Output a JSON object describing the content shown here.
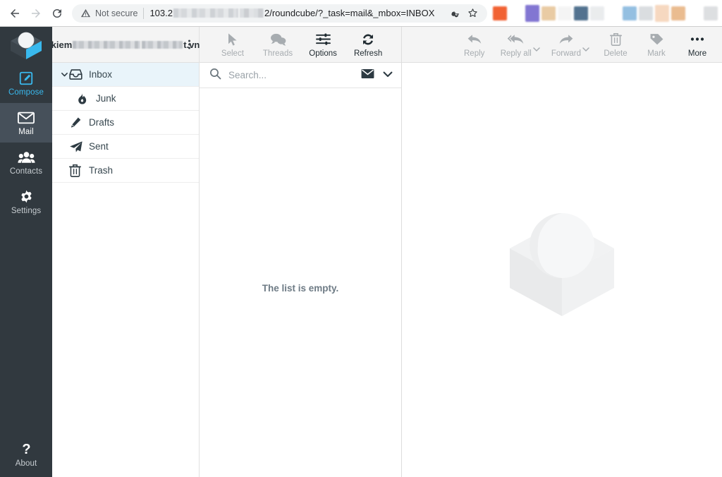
{
  "browser": {
    "back_icon": "arrow-left-icon",
    "forward_icon": "arrow-right-icon",
    "reload_icon": "reload-icon",
    "security_icon": "warning-triangle-icon",
    "security_label": "Not secure",
    "url_prefix": "103.2",
    "url_mid": "2",
    "url_suffix": "/roundcube/?_task=mail&_mbox=INBOX",
    "url_full": "103.2xx.xxx.xx2/roundcube/?_task=mail&_mbox=INBOX",
    "key_icon": "key-icon",
    "star_icon": "star-outline-icon",
    "extension_colors": [
      "#f15a29",
      "#7c6fd0",
      "#e8c9a0",
      "#4a6b8a",
      "#d8dadc",
      "#8fbce0",
      "#f6d6bd",
      "#e9b98b",
      "#dcdee0"
    ]
  },
  "taskmenu": {
    "brand_name": "roundcube-logo",
    "items": [
      {
        "label": "Compose",
        "icon": "compose-pencil-icon",
        "state": "link"
      },
      {
        "label": "Mail",
        "icon": "envelope-icon",
        "state": "active"
      },
      {
        "label": "Contacts",
        "icon": "people-icon",
        "state": "normal"
      },
      {
        "label": "Settings",
        "icon": "gear-icon",
        "state": "normal"
      }
    ],
    "about": {
      "label": "About",
      "icon": "question-mark-icon"
    }
  },
  "folders": {
    "account": "kiem@t.vn",
    "account_prefix": "kiem",
    "account_suffix": "t.vn",
    "options_icon": "kebab-menu-icon",
    "items": [
      {
        "label": "Inbox",
        "icon": "inbox-icon",
        "selected": true,
        "child": false,
        "twisty": "chevron-down-icon"
      },
      {
        "label": "Junk",
        "icon": "fire-icon",
        "selected": false,
        "child": true,
        "twisty": ""
      },
      {
        "label": "Drafts",
        "icon": "pencil-icon",
        "selected": false,
        "child": false,
        "twisty": ""
      },
      {
        "label": "Sent",
        "icon": "paper-plane-icon",
        "selected": false,
        "child": false,
        "twisty": ""
      },
      {
        "label": "Trash",
        "icon": "trash-icon",
        "selected": false,
        "child": false,
        "twisty": ""
      }
    ]
  },
  "list_toolbar": {
    "buttons": [
      {
        "label": "Select",
        "icon": "cursor-arrow-icon",
        "disabled": true
      },
      {
        "label": "Threads",
        "icon": "threads-bubbles-icon",
        "disabled": true
      },
      {
        "label": "Options",
        "icon": "sliders-icon",
        "disabled": false
      },
      {
        "label": "Refresh",
        "icon": "refresh-icon",
        "disabled": false
      }
    ]
  },
  "search": {
    "placeholder": "Search...",
    "search_icon": "search-icon",
    "scope_icon": "envelope-filled-icon",
    "expand_icon": "chevron-down-icon"
  },
  "message_list": {
    "empty_text": "The list is empty."
  },
  "message_toolbar": {
    "buttons": [
      {
        "label": "Reply",
        "icon": "reply-arrow-icon",
        "disabled": true,
        "split": false
      },
      {
        "label": "Reply all",
        "icon": "reply-all-arrow-icon",
        "disabled": true,
        "split": true
      },
      {
        "label": "Forward",
        "icon": "forward-arrow-icon",
        "disabled": true,
        "split": true
      },
      {
        "label": "Delete",
        "icon": "trash-icon",
        "disabled": true,
        "split": false
      },
      {
        "label": "Mark",
        "icon": "tag-icon",
        "disabled": true,
        "split": false
      },
      {
        "label": "More",
        "icon": "ellipsis-icon",
        "disabled": false,
        "split": false
      }
    ]
  },
  "message_view": {
    "watermark_icon": "roundcube-watermark-logo"
  },
  "colors": {
    "taskmenu_bg": "#31393f",
    "taskmenu_active_bg": "#46505a",
    "accent_blue": "#39b9ee",
    "selected_folder_bg": "#e9f4fa",
    "toolbar_bg": "#f4f4f4",
    "disabled_text": "#a7acb0"
  }
}
